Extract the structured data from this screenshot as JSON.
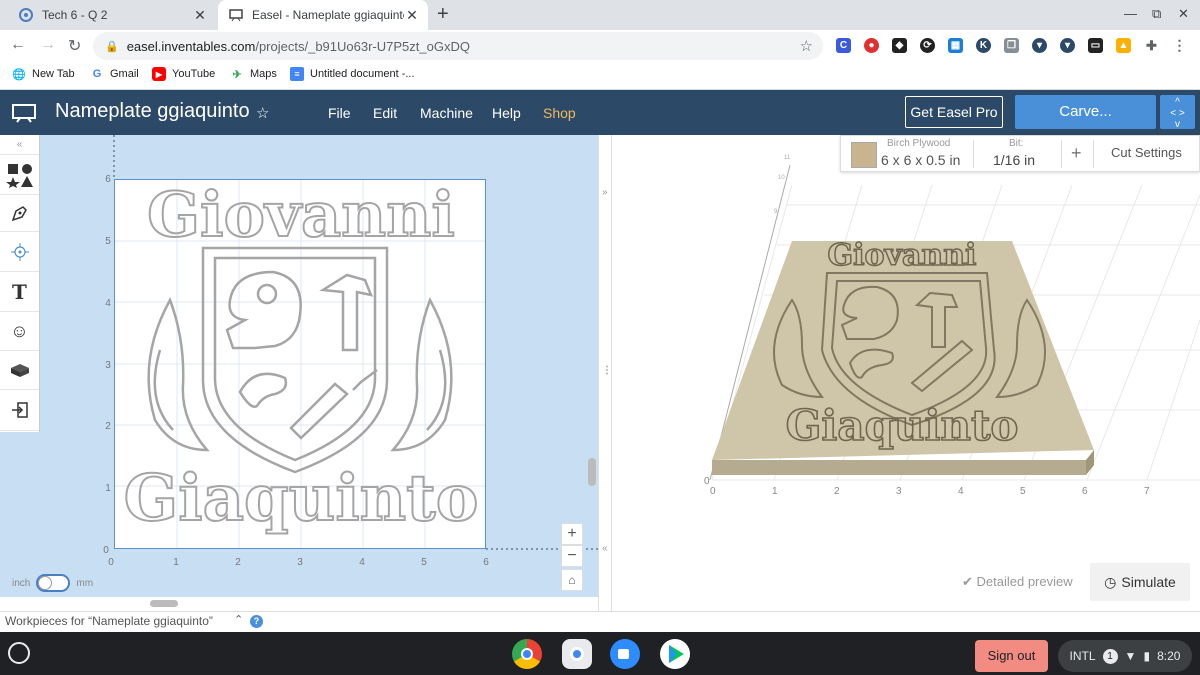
{
  "browser": {
    "tabs": [
      {
        "title": "Tech 6 - Q 2",
        "icon": "chrome-app-icon"
      },
      {
        "title": "Easel - Nameplate ggiaquinto",
        "icon": "easel-tab-icon"
      }
    ],
    "address": {
      "host": "easel.inventables.com",
      "path": "/projects/_b91Uo63r-U7P5zt_oGxDQ"
    },
    "bookmarks": [
      "New Tab",
      "Gmail",
      "YouTube",
      "Maps",
      "Untitled document -..."
    ]
  },
  "easel": {
    "project_title": "Nameplate ggiaquinto",
    "menu": [
      "File",
      "Edit",
      "Machine",
      "Help",
      "Shop"
    ],
    "get_pro": "Get Easel Pro",
    "carve": "Carve...",
    "material": {
      "name": "Birch Plywood",
      "size": "6 x 6 x 0.5 in",
      "swatch_color": "#c8b48e"
    },
    "bit": {
      "label": "Bit:",
      "value": "1/16 in"
    },
    "cut_settings": "Cut Settings",
    "design": {
      "top_text": "Giovanni",
      "bottom_text": "Giaquinto"
    },
    "units": {
      "left": "inch",
      "right": "mm"
    },
    "canvas_axis_x": [
      "0",
      "1",
      "2",
      "3",
      "4",
      "5",
      "6"
    ],
    "canvas_axis_y": [
      "0",
      "1",
      "2",
      "3",
      "4",
      "5",
      "6"
    ],
    "preview_axis_x": [
      "0",
      "1",
      "2",
      "3",
      "4",
      "5",
      "6",
      "7"
    ],
    "detailed_preview": "Detailed preview",
    "simulate": "Simulate",
    "workpieces": "Workpieces for “Nameplate ggiaquinto”"
  },
  "os": {
    "sign_out": "Sign out",
    "ime": "INTL",
    "notifications": "1",
    "time": "8:20"
  },
  "colors": {
    "header": "#2c4a68",
    "accent": "#4a90d9",
    "canvas_bg": "#c8def3",
    "shop": "#f0b75c"
  }
}
